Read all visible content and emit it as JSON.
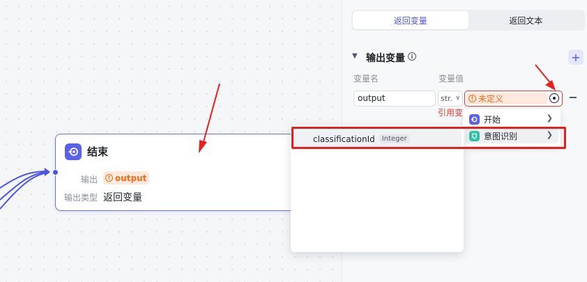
{
  "canvas": {
    "end_node": {
      "title": "结束",
      "output_label": "输出",
      "output_value": "output",
      "output_type_label": "输出类型",
      "output_type_value": "返回变量"
    }
  },
  "panel": {
    "tabs": [
      {
        "label": "返回变量",
        "active": true
      },
      {
        "label": "返回文本",
        "active": false
      }
    ],
    "section_title": "输出变量",
    "add_label": "+",
    "columns": {
      "name": "变量名",
      "value": "变量值"
    },
    "row": {
      "name_value": "output",
      "type_value": "str.",
      "value_status": "未定义",
      "error_text": "引用变"
    }
  },
  "node_menu": {
    "items": [
      {
        "label": "开始",
        "icon": "start-node-icon"
      },
      {
        "label": "意图识别",
        "icon": "intent-node-icon"
      }
    ]
  },
  "variable_menu": {
    "items": [
      {
        "name": "classificationId",
        "type": "Integer"
      }
    ]
  },
  "colors": {
    "accent": "#4d53e8",
    "warning": "#f06b1a",
    "error": "#e5392e",
    "annotation": "#e5201e"
  }
}
